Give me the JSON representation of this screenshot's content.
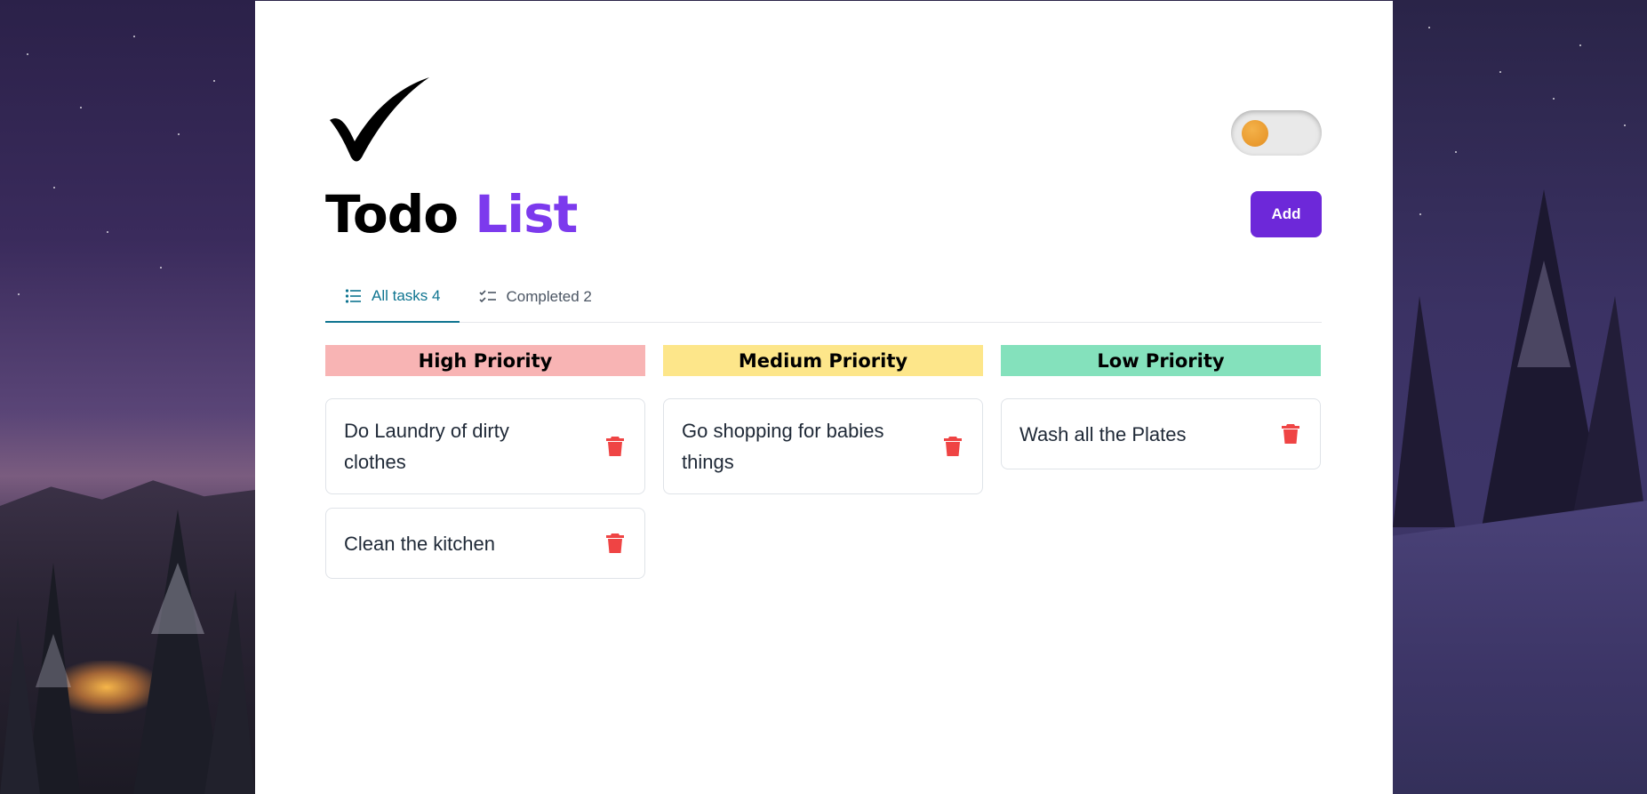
{
  "header": {
    "title_part1": "Todo",
    "title_part2": "List",
    "add_label": "Add",
    "theme_toggle": "off",
    "logo_icon": "checkmark-icon"
  },
  "tabs": [
    {
      "label": "All tasks 4",
      "icon": "list-icon",
      "active": true
    },
    {
      "label": "Completed 2",
      "icon": "checklist-icon",
      "active": false
    }
  ],
  "columns": [
    {
      "title": "High Priority",
      "color": "#f8b4b4",
      "tasks": [
        {
          "text": "Do Laundry of dirty clothes"
        },
        {
          "text": "Clean the kitchen"
        }
      ]
    },
    {
      "title": "Medium Priority",
      "color": "#fde68a",
      "tasks": [
        {
          "text": "Go shopping for babies things"
        }
      ]
    },
    {
      "title": "Low Priority",
      "color": "#84e1bc",
      "tasks": [
        {
          "text": "Wash all the Plates"
        }
      ]
    }
  ],
  "colors": {
    "accent": "#7c3aed",
    "button": "#6d28d9",
    "tab_active": "#0e7490",
    "delete_icon": "#ef4444"
  }
}
